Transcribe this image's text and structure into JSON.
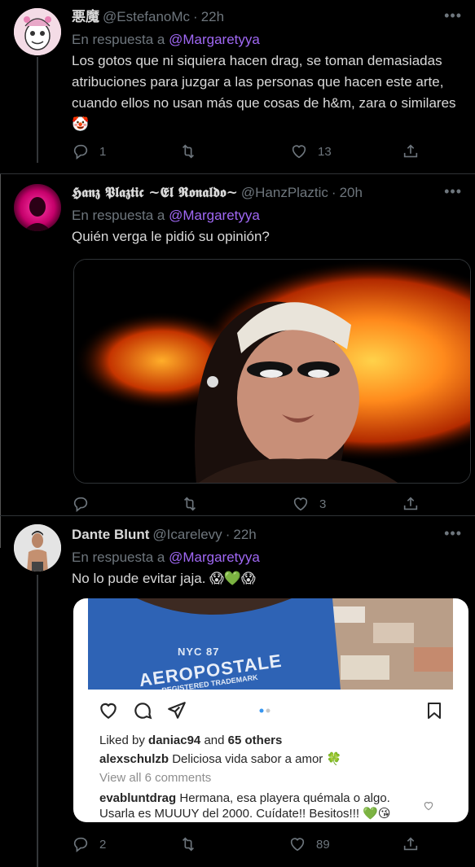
{
  "tweets": [
    {
      "name": "悪魔",
      "handle": "@EstefanoMc",
      "time": "22h",
      "reply_prefix": "En respuesta a",
      "reply_to": "@Margaretyya",
      "body": "Los gotos que ni siquiera hacen drag, se toman demasiadas atribuciones para juzgar a las personas que hacen este arte, cuando ellos no usan más que cosas de h&m, zara o similares 🤡",
      "replies": "1",
      "retweets": "",
      "likes": "13"
    },
    {
      "name": "𝕳𝖆𝖓𝖟 𝕻𝖑𝖆𝖟𝖙𝖎𝖈 ~𝕰𝖑 𝕽𝖔𝖓𝖆𝖑𝖉𝖔~",
      "handle": "@HanzPlaztic",
      "time": "20h",
      "reply_prefix": "En respuesta a",
      "reply_to": "@Margaretyya",
      "body": "Quién verga le pidió su opinión?",
      "replies": "",
      "retweets": "",
      "likes": "3"
    },
    {
      "name": "Dante Blunt",
      "handle": "@Icarelevy",
      "time": "22h",
      "reply_prefix": "En respuesta a",
      "reply_to": "@Margaretyya",
      "body": "No lo pude evitar jaja. 😱💚😱",
      "replies": "2",
      "retweets": "",
      "likes": "89"
    }
  ],
  "instagram": {
    "shirt_text_1": "NYC 87",
    "shirt_text_2": "AEROPOSTALE",
    "shirt_text_3": "REGISTERED TRADEMARK",
    "liked_by_prefix": "Liked by",
    "liked_by_user": "daniac94",
    "liked_by_and": "and",
    "liked_by_others": "65 others",
    "comment1_user": "alexschulzb",
    "comment1_text": "Deliciosa vida sabor a amor 🍀",
    "view_all": "View all 6 comments",
    "comment2_user": "evabluntdrag",
    "comment2_text": "Hermana, esa playera quémala o algo. Usarla es MUUUY del 2000. Cuídate!! Besitos!!! 💚😘"
  },
  "more_glyph": "•••",
  "colors": {
    "background": "#000000",
    "text": "#d9d9d9",
    "secondary": "#6e767d",
    "mention": "#a068f4",
    "border": "#2f3336"
  },
  "icons": [
    "reply-icon",
    "retweet-icon",
    "like-icon",
    "share-icon",
    "more-icon"
  ]
}
